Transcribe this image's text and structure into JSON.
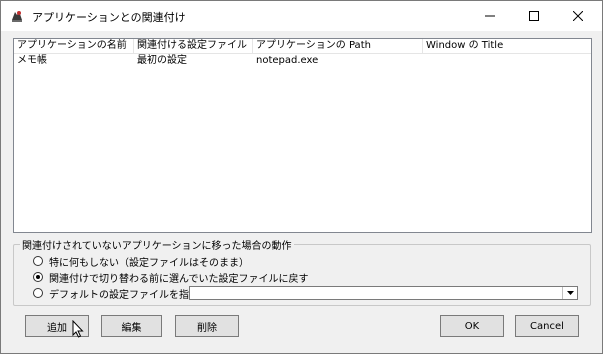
{
  "window": {
    "title": "アプリケーションとの関連付け"
  },
  "list": {
    "columns": [
      "アプリケーションの名前",
      "関連付ける設定ファイル",
      "アプリケーションの Path",
      "Window の Title"
    ],
    "rows": [
      [
        "メモ帳",
        "最初の設定",
        "notepad.exe",
        ""
      ]
    ]
  },
  "group": {
    "legend": "関連付けされていないアプリケーションに移った場合の動作",
    "options": [
      {
        "label": "特に何もしない（設定ファイルはそのまま）",
        "checked": false
      },
      {
        "label": "関連付けで切り替わる前に選んでいた設定ファイルに戻す",
        "checked": true
      },
      {
        "label": "デフォルトの設定ファイルを指定",
        "checked": false
      }
    ],
    "default_file_value": ""
  },
  "buttons": {
    "add": "追加",
    "edit": "編集",
    "delete": "削除",
    "ok": "OK",
    "cancel": "Cancel"
  }
}
